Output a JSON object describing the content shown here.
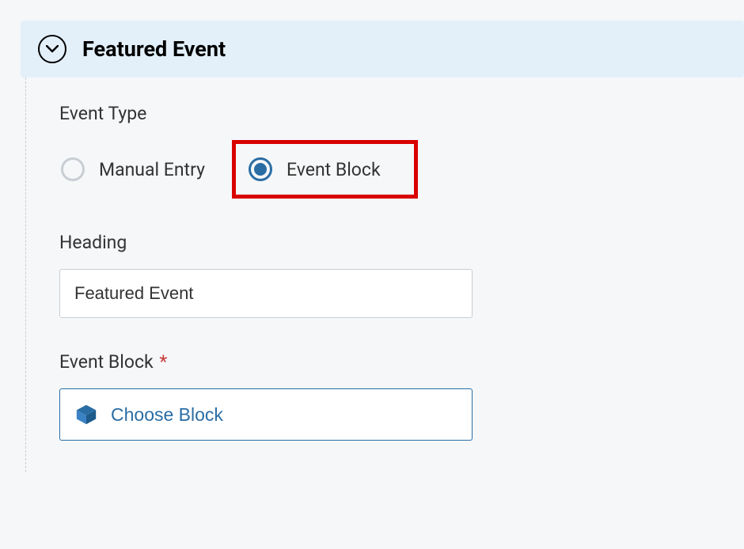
{
  "panel": {
    "title": "Featured Event"
  },
  "event_type": {
    "label": "Event Type",
    "options": {
      "manual": "Manual Entry",
      "block": "Event Block"
    },
    "selected": "block"
  },
  "heading": {
    "label": "Heading",
    "value": "Featured Event"
  },
  "event_block": {
    "label": "Event Block",
    "required_marker": "*",
    "button_label": "Choose Block"
  }
}
